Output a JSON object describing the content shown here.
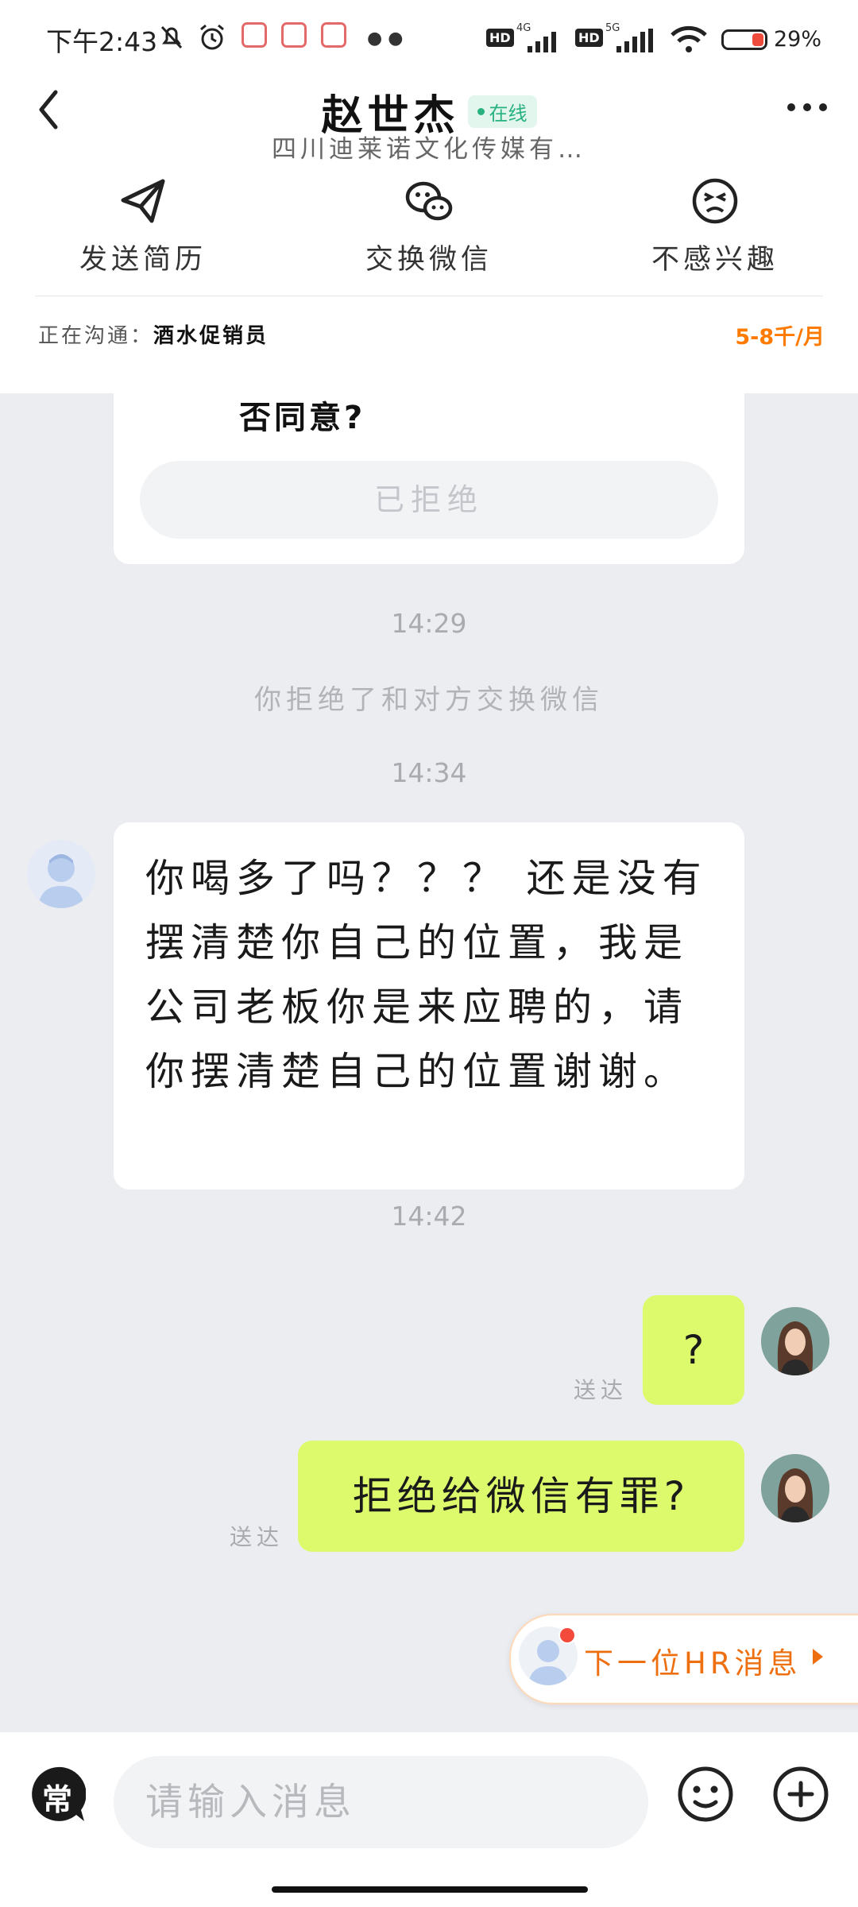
{
  "status_bar": {
    "time": "下午2:43",
    "network_4g": "4G",
    "network_5g": "5G",
    "hd_label": "HD",
    "battery": "29%"
  },
  "header": {
    "name": "赵世杰",
    "online": "在线",
    "company": "四川迪莱诺文化传媒有…",
    "actions": [
      {
        "label": "发送简历",
        "icon": "send-icon"
      },
      {
        "label": "交换微信",
        "icon": "wechat-icon"
      },
      {
        "label": "不感兴趣",
        "icon": "uninterested-face-icon"
      }
    ],
    "job_prefix": "正在沟通：",
    "job_title": "酒水促销员",
    "salary": "5-8千/月"
  },
  "chat": {
    "card_text": "否同意?",
    "card_button": "已拒绝",
    "time_1": "14:29",
    "system_notice": "你拒绝了和对方交换微信",
    "time_2": "14:34",
    "received_message": "你喝多了吗？？？ 还是没有摆清楚你自己的位置，我是公司老板你是来应聘的，请你摆清楚自己的位置谢谢。",
    "time_3": "14:42",
    "sent_1": "?",
    "sent_2": "拒绝给微信有罪?",
    "delivered": "送达",
    "next_hr": "下一位HR消息"
  },
  "input_bar": {
    "quick_label": "常",
    "placeholder": "请输入消息"
  },
  "colors": {
    "accent_green": "#27b27f",
    "sent_bubble": "#dcfa6c",
    "salary_orange": "#ff7a00"
  }
}
